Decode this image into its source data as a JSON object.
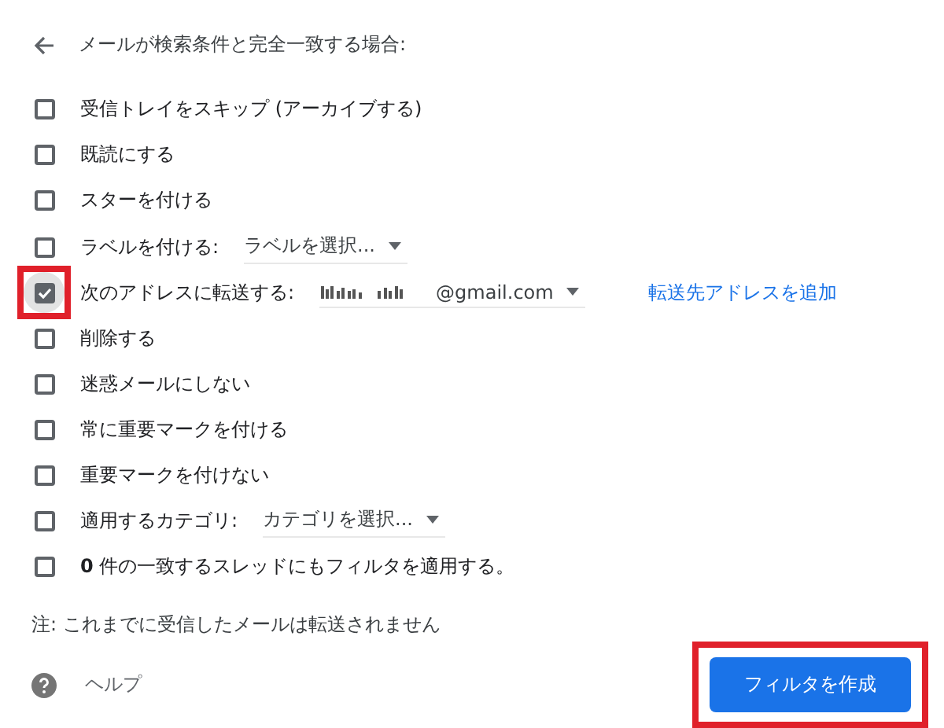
{
  "header": {
    "title": "メールが検索条件と完全一致する場合:"
  },
  "options": [
    {
      "kind": "plain",
      "label": "受信トレイをスキップ (アーカイブする)",
      "checked": false,
      "highlighted": false
    },
    {
      "kind": "plain",
      "label": "既読にする",
      "checked": false,
      "highlighted": false
    },
    {
      "kind": "plain",
      "label": "スターを付ける",
      "checked": false,
      "highlighted": false
    },
    {
      "kind": "select",
      "label": "ラベルを付ける:",
      "value": "ラベルを選択...",
      "checked": false,
      "highlighted": false
    },
    {
      "kind": "forward",
      "label": "次のアドレスに転送する:",
      "value": "@gmail.com",
      "redacted": true,
      "link": "転送先アドレスを追加",
      "checked": true,
      "highlighted": true
    },
    {
      "kind": "plain",
      "label": "削除する",
      "checked": false,
      "highlighted": false
    },
    {
      "kind": "plain",
      "label": "迷惑メールにしない",
      "checked": false,
      "highlighted": false
    },
    {
      "kind": "plain",
      "label": "常に重要マークを付ける",
      "checked": false,
      "highlighted": false
    },
    {
      "kind": "plain",
      "label": "重要マークを付けない",
      "checked": false,
      "highlighted": false
    },
    {
      "kind": "select",
      "label": "適用するカテゴリ:",
      "value": "カテゴリを選択...",
      "checked": false,
      "highlighted": false
    },
    {
      "kind": "plain",
      "label": "**0** 件の一致するスレッドにもフィルタを適用する。",
      "checked": false,
      "highlighted": false
    }
  ],
  "note": "注: これまでに受信したメールは転送されません",
  "help": "ヘルプ",
  "create_button": {
    "label": "フィルタを作成",
    "highlighted": true
  }
}
